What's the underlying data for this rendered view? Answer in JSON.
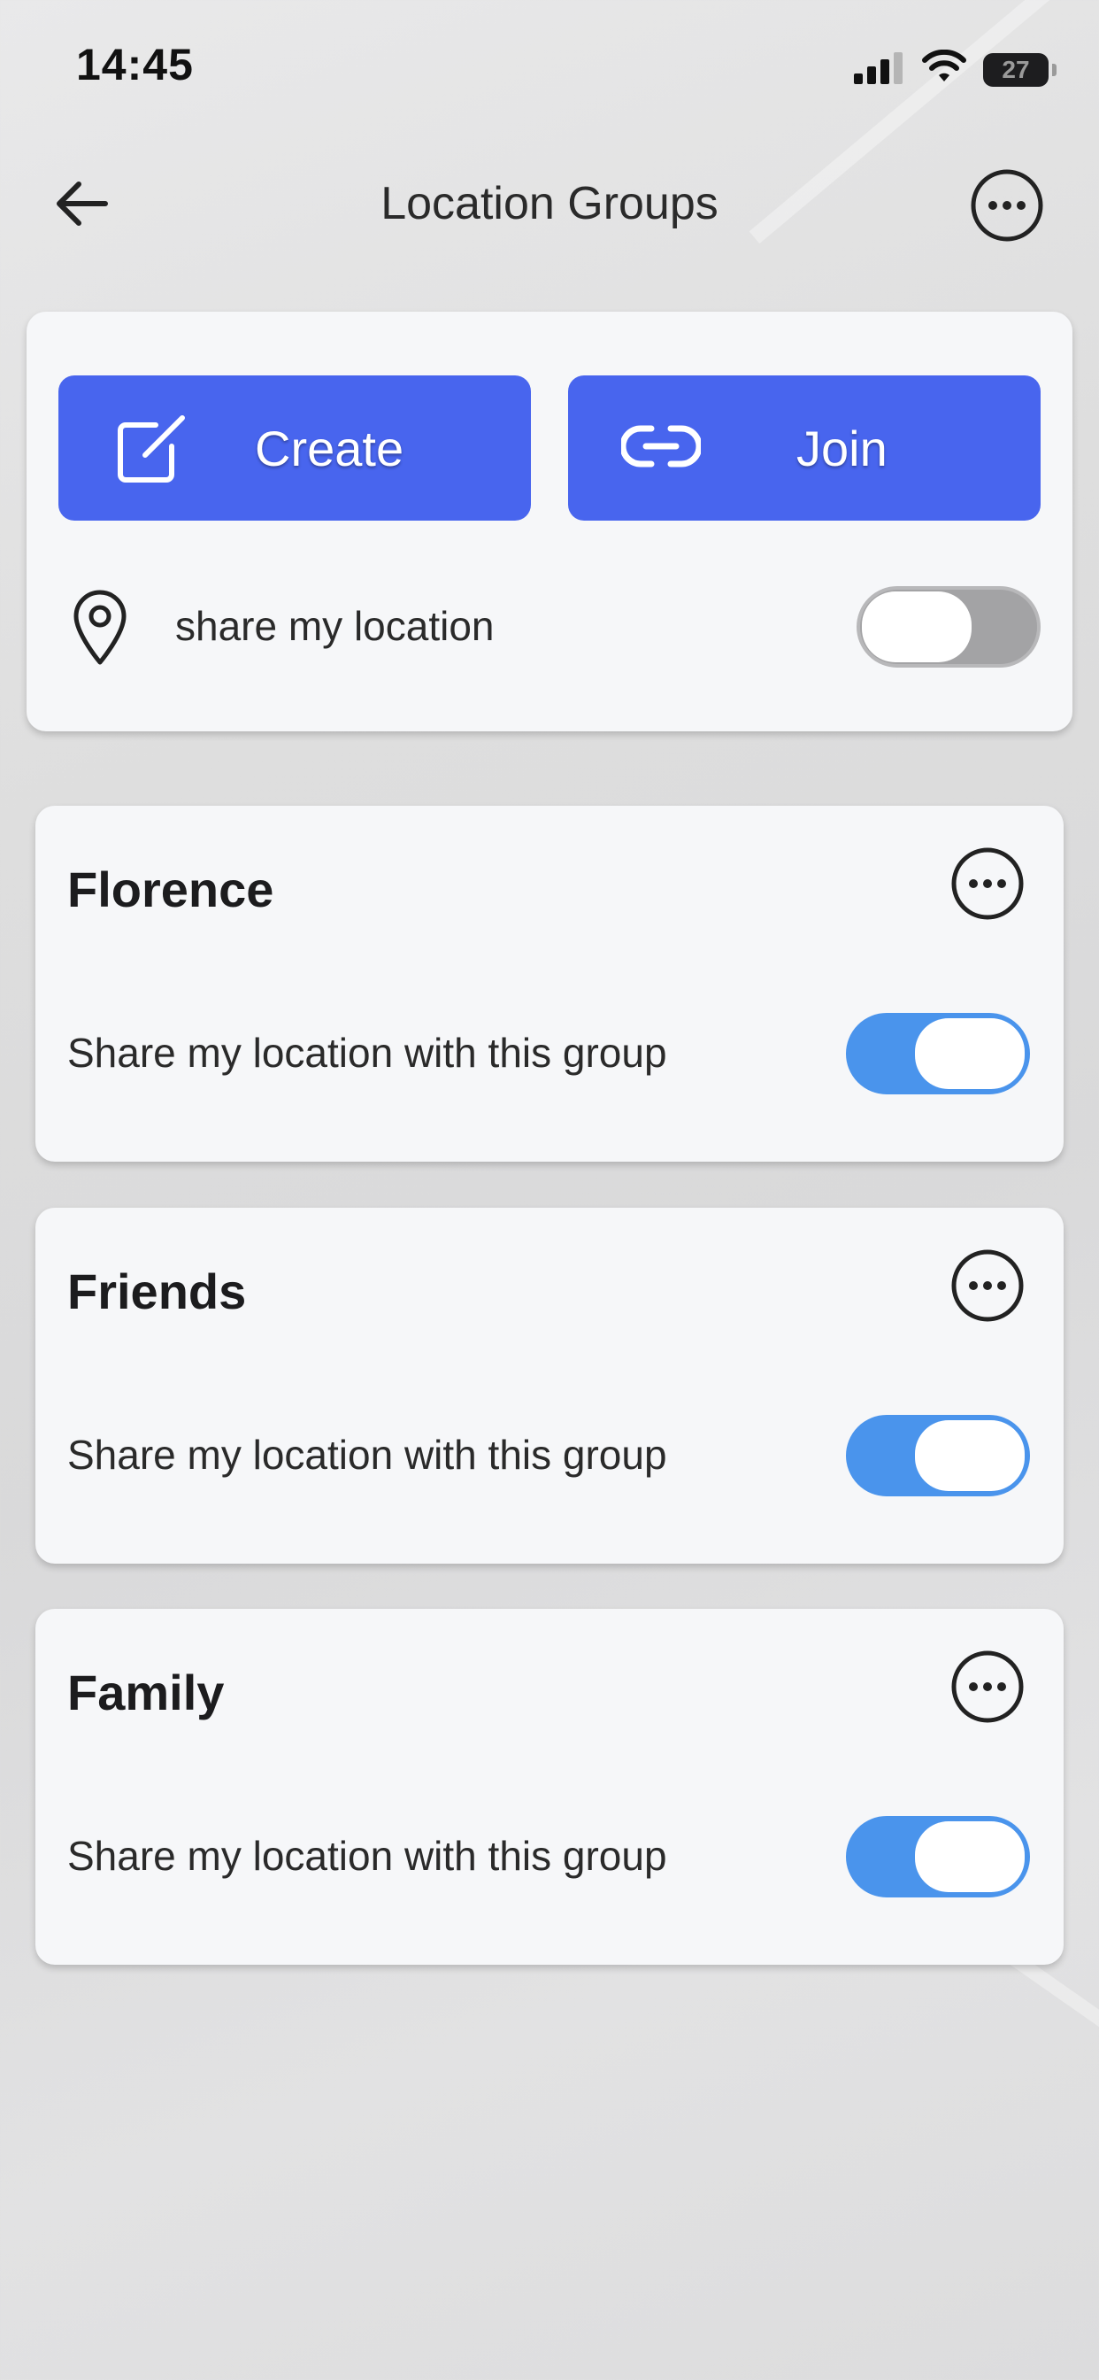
{
  "status_bar": {
    "time": "14:45",
    "battery": "27"
  },
  "header": {
    "title": "Location Groups"
  },
  "actions": {
    "create_label": "Create",
    "join_label": "Join"
  },
  "share_location": {
    "label": "share my location",
    "enabled": false
  },
  "groups": [
    {
      "name": "Florence",
      "share_label": "Share my location with this group",
      "enabled": true
    },
    {
      "name": "Friends",
      "share_label": "Share my location with this group",
      "enabled": true
    },
    {
      "name": "Family",
      "share_label": "Share my location with this group",
      "enabled": true
    }
  ],
  "colors": {
    "accent": "#4865ee",
    "toggle_on": "#4a94ec",
    "toggle_off": "#a3a3a5",
    "card_bg": "#f6f7f9"
  }
}
